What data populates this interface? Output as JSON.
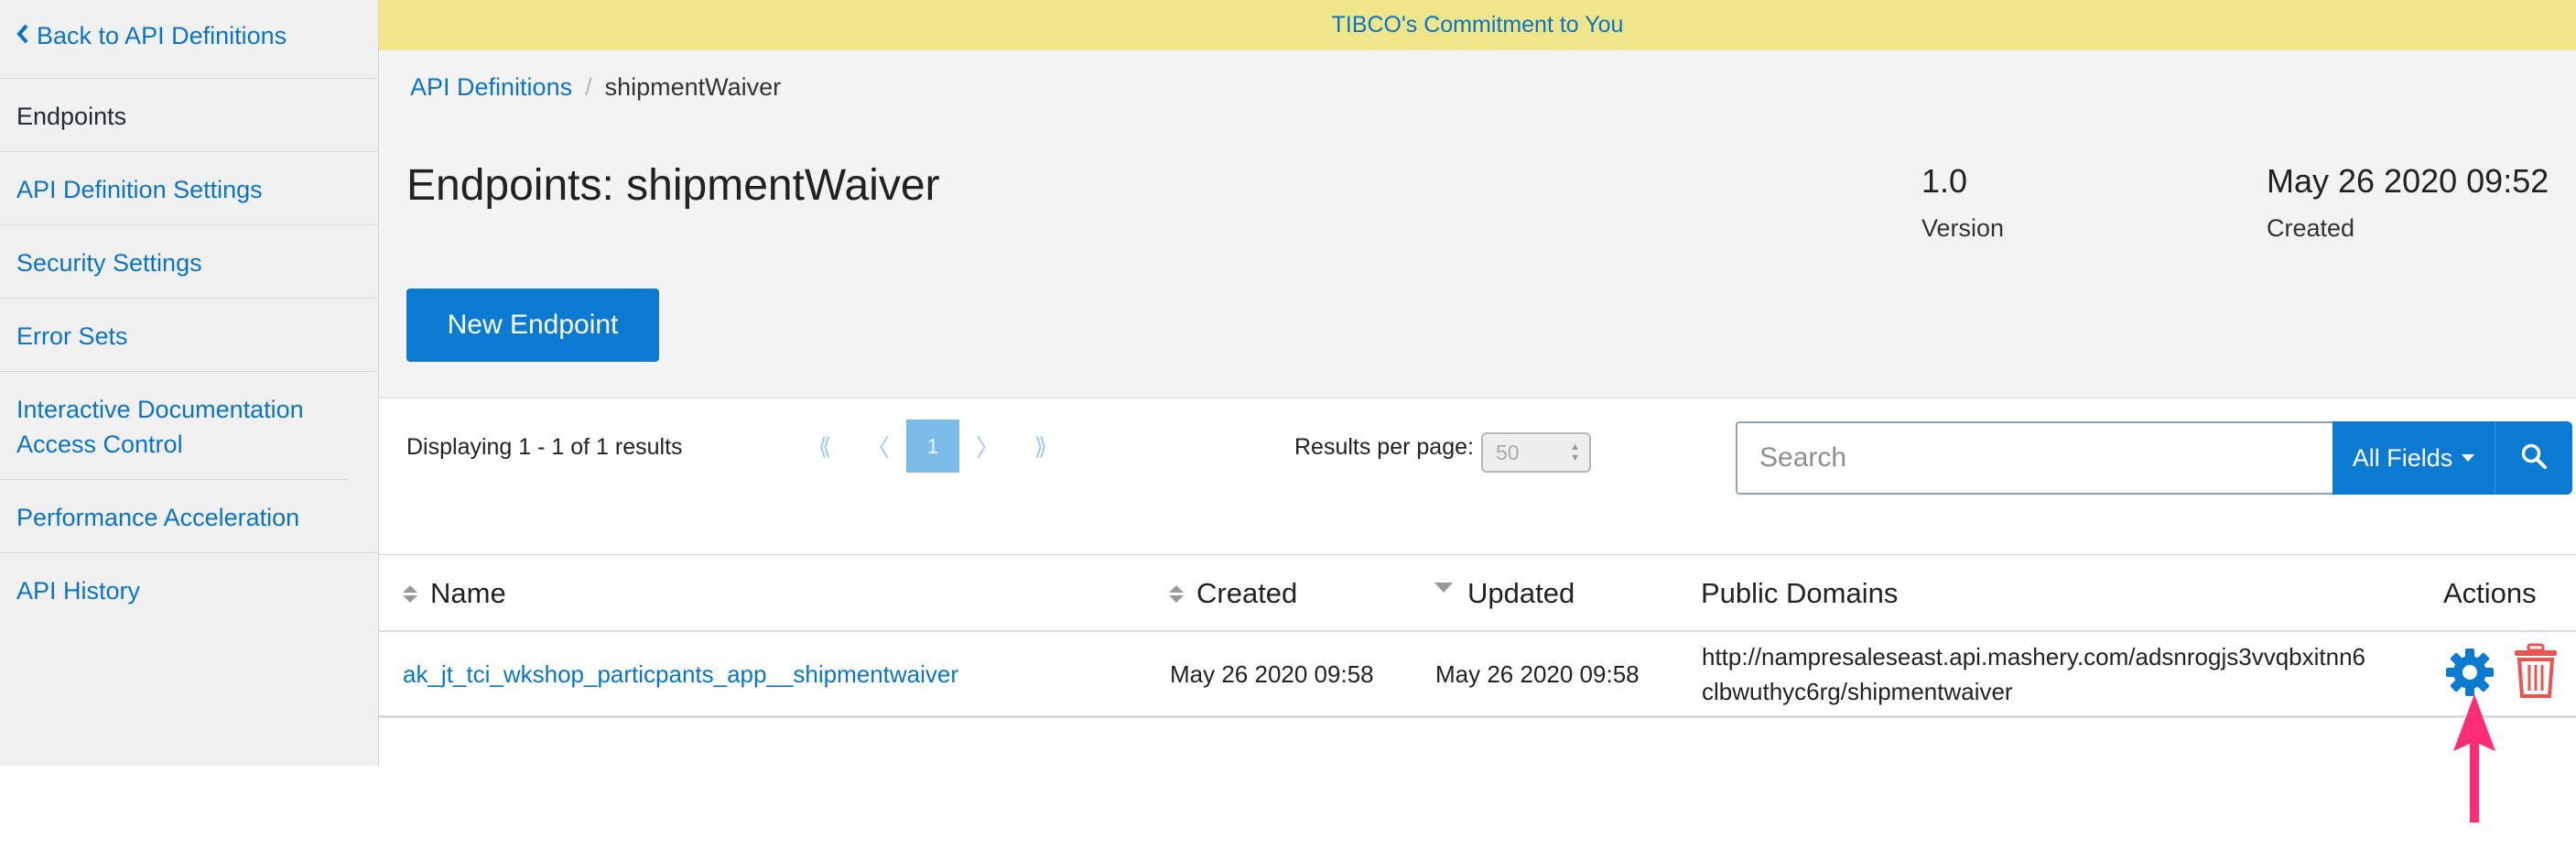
{
  "sidebar": {
    "back_label": "Back to API Definitions",
    "items": [
      {
        "label": "Endpoints",
        "active": true
      },
      {
        "label": "API Definition Settings"
      },
      {
        "label": "Security Settings"
      },
      {
        "label": "Error Sets"
      },
      {
        "label": "Interactive Documentation Access Control"
      },
      {
        "label": "Performance Acceleration"
      },
      {
        "label": "API History"
      }
    ]
  },
  "banner": {
    "text": "TIBCO's Commitment to You"
  },
  "breadcrumb": {
    "parent": "API Definitions",
    "separator": "/",
    "current": "shipmentWaiver"
  },
  "header": {
    "title": "Endpoints: shipmentWaiver",
    "version_value": "1.0",
    "version_label": "Version",
    "created_value": "May 26 2020 09:52",
    "created_label": "Created"
  },
  "actions": {
    "new_endpoint": "New Endpoint"
  },
  "results": {
    "summary": "Displaying 1 - 1 of 1 results"
  },
  "pagination": {
    "first": "⟪",
    "prev": "〈",
    "current": "1",
    "next": "〉",
    "last": "⟫"
  },
  "per_page": {
    "label": "Results per page:",
    "value": "50"
  },
  "search": {
    "placeholder": "Search",
    "fields_label": "All Fields"
  },
  "table": {
    "columns": {
      "name": "Name",
      "created": "Created",
      "updated": "Updated",
      "domains": "Public Domains",
      "actions": "Actions"
    },
    "rows": [
      {
        "name": "ak_jt_tci_wkshop_particpants_app__shipmentwaiver",
        "created": "May 26 2020 09:58",
        "updated": "May 26 2020 09:58",
        "domain_line1": "http://nampresaleseast.api.mashery.com/adsnrogjs3vvqbxitnn6",
        "domain_line2": "clbwuthyc6rg/shipmentwaiver"
      }
    ]
  },
  "colors": {
    "accent": "#0b7ad1",
    "link": "#0b74c7",
    "banner": "#efe58a",
    "delete": "#e8554f",
    "pointer": "#ff2d78"
  },
  "icons": [
    "chevron-left-icon",
    "search-icon",
    "caret-down-icon",
    "sort-icon",
    "gear-icon",
    "trash-icon",
    "pointer-arrow-icon"
  ]
}
